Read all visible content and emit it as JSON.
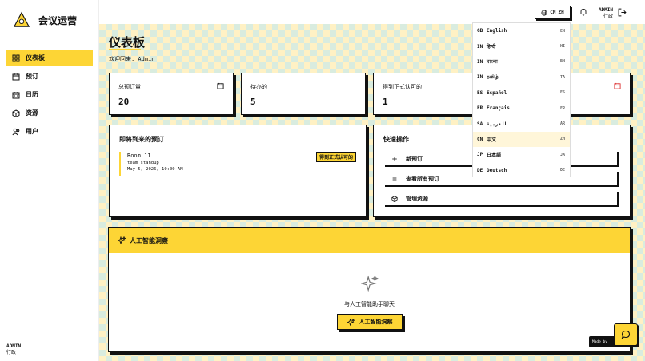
{
  "app": {
    "title": "会议运营"
  },
  "sidebar": {
    "items": [
      {
        "label": "仪表板",
        "icon": "dashboard-icon",
        "active": true
      },
      {
        "label": "预订",
        "icon": "calendar-check-icon",
        "active": false
      },
      {
        "label": "日历",
        "icon": "calendar-icon",
        "active": false
      },
      {
        "label": "资源",
        "icon": "box-icon",
        "active": false
      },
      {
        "label": "用户",
        "icon": "users-icon",
        "active": false
      }
    ],
    "user": {
      "name": "ADMIN",
      "role": "行政"
    }
  },
  "topbar": {
    "language": {
      "flag": "CN",
      "code": "ZH"
    },
    "user": {
      "name": "ADMIN",
      "role": "行政"
    }
  },
  "header": {
    "title": "仪表板",
    "welcome": "欢迎回来, Admin"
  },
  "stats": [
    {
      "label": "总预订量",
      "value": "20"
    },
    {
      "label": "待办的",
      "value": "5"
    },
    {
      "label": "得到正式认可的",
      "value": "1"
    }
  ],
  "upcoming": {
    "title": "即将到来的预订",
    "booking": {
      "room": "Room 11",
      "description": "team standup",
      "date": "May 5, 2026, 10:00 AM",
      "status": "得到正式认可的"
    }
  },
  "quick_actions": {
    "title": "快速操作",
    "items": [
      {
        "label": "新预订",
        "icon": "plus-icon"
      },
      {
        "label": "查看所有预订",
        "icon": "list-icon"
      },
      {
        "label": "管理资源",
        "icon": "box-icon"
      }
    ]
  },
  "ai": {
    "title": "人工智能洞察",
    "prompt": "与人工智能助手聊天",
    "button_label": "人工智能洞察"
  },
  "languages": [
    {
      "cc": "GB",
      "name": "English",
      "code": "EN"
    },
    {
      "cc": "IN",
      "name": "हिन्दी",
      "code": "HI"
    },
    {
      "cc": "IN",
      "name": "বাংলা",
      "code": "BN"
    },
    {
      "cc": "IN",
      "name": "தமிழ்",
      "code": "TA"
    },
    {
      "cc": "ES",
      "name": "Español",
      "code": "ES"
    },
    {
      "cc": "FR",
      "name": "Français",
      "code": "FR"
    },
    {
      "cc": "SA",
      "name": "العربية",
      "code": "AR"
    },
    {
      "cc": "CN",
      "name": "中文",
      "code": "ZH",
      "active": true
    },
    {
      "cc": "JP",
      "name": "日本語",
      "code": "JA"
    },
    {
      "cc": "DE",
      "name": "Deutsch",
      "code": "DE"
    }
  ],
  "made_by": "Made by",
  "colors": {
    "accent": "#FDD535",
    "checker_a": "#FFF1C4",
    "checker_b": "#D9ECDF"
  }
}
